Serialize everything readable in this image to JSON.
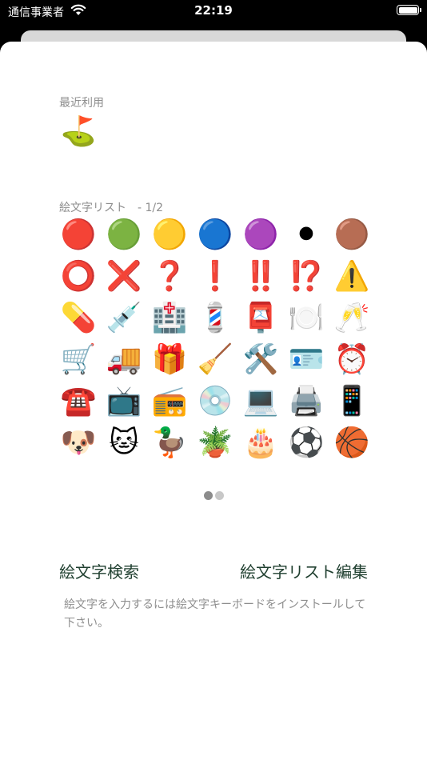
{
  "status_bar": {
    "carrier": "通信事業者",
    "time": "22:19"
  },
  "recent": {
    "label": "最近利用",
    "emojis": [
      "⛳"
    ]
  },
  "emoji_list": {
    "label": "絵文字リスト　-  1/2",
    "emojis": [
      "🔴",
      "🟢",
      "🟡",
      "🔵",
      "🟣",
      "⚫",
      "🟤",
      "⭕",
      "❌",
      "❓",
      "❗",
      "‼️",
      "⁉️",
      "⚠️",
      "💊",
      "💉",
      "🏥",
      "💈",
      "📮",
      "🍽️",
      "🥂",
      "🛒",
      "🚚",
      "🎁",
      "🧹",
      "🛠️",
      "🪪",
      "⏰",
      "☎️",
      "📺",
      "📻",
      "💿",
      "💻",
      "🖨️",
      "📱",
      "🐶",
      "🐱",
      "🦆",
      "🪴",
      "🎂",
      "⚽",
      "🏀"
    ]
  },
  "pagination": {
    "pages": 2,
    "current": 1
  },
  "actions": {
    "search_label": "絵文字検索",
    "edit_label": "絵文字リスト編集"
  },
  "note": "絵文字を入力するには絵文字キーボードをインストールして下さい。"
}
